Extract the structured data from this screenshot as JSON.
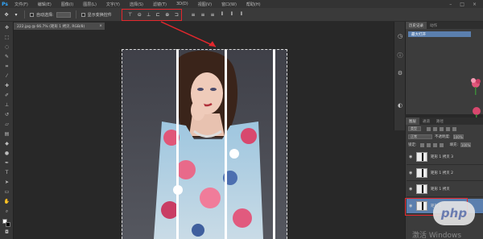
{
  "app": {
    "logo": "Ps"
  },
  "menubar": {
    "items": [
      "文件(F)",
      "编辑(E)",
      "图像(I)",
      "图层(L)",
      "文字(Y)",
      "选择(S)",
      "滤镜(T)",
      "3D(D)",
      "视图(V)",
      "窗口(W)",
      "帮助(H)"
    ],
    "window_controls": [
      "–",
      "□",
      "×"
    ]
  },
  "options": {
    "auto_select_label": "自动选择:",
    "auto_select_value": "组",
    "show_transform_label": "显示变换控件"
  },
  "document": {
    "tab_label": "222.jpg @ 66.7% (矩形 1 拷贝, RGB/8)",
    "close": "×"
  },
  "history_panel": {
    "tabs": [
      "历史记录",
      "动作"
    ],
    "item": "最大打开"
  },
  "layers_panel": {
    "tabs": [
      "图层",
      "通道",
      "路径"
    ],
    "kind_label": "类型",
    "blend_mode": "正常",
    "opacity_label": "不透明度:",
    "opacity_value": "100%",
    "lock_label": "锁定:",
    "fill_label": "填充:",
    "fill_value": "100%",
    "layers": [
      {
        "name": "矩形 1 拷贝 3"
      },
      {
        "name": "矩形 1 拷贝 2"
      },
      {
        "name": "矩形 1 拷贝"
      },
      {
        "name": "矩形 1"
      }
    ]
  },
  "watermark": "激活 Windows",
  "php_badge": "php",
  "colors": {
    "highlight": "#e3272d",
    "selection": "#5b7fae",
    "ps_blue": "#31a8ff"
  }
}
